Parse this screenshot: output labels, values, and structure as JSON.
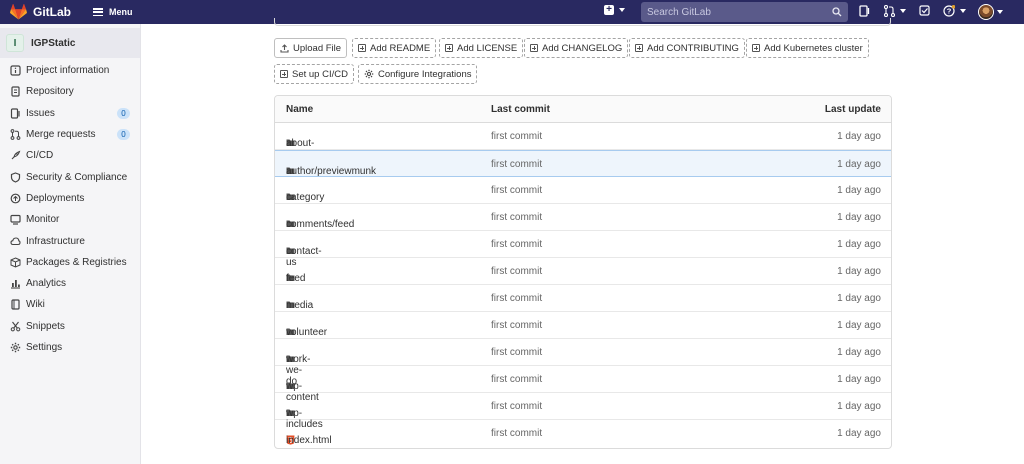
{
  "topbar": {
    "brand": "GitLab",
    "menu_label": "Menu",
    "search_placeholder": "Search GitLab"
  },
  "sidebar": {
    "project_initial": "I",
    "project_name": "IGPStatic",
    "items": [
      {
        "label": "Project information",
        "icon": "info-icon"
      },
      {
        "label": "Repository",
        "icon": "doc-icon"
      },
      {
        "label": "Issues",
        "icon": "issues-icon",
        "badge": "0"
      },
      {
        "label": "Merge requests",
        "icon": "merge-request-icon",
        "badge": "0"
      },
      {
        "label": "CI/CD",
        "icon": "rocket-icon"
      },
      {
        "label": "Security & Compliance",
        "icon": "shield-icon"
      },
      {
        "label": "Deployments",
        "icon": "deployments-icon"
      },
      {
        "label": "Monitor",
        "icon": "monitor-icon"
      },
      {
        "label": "Infrastructure",
        "icon": "cloud-icon"
      },
      {
        "label": "Packages & Registries",
        "icon": "package-icon"
      },
      {
        "label": "Analytics",
        "icon": "chart-icon"
      },
      {
        "label": "Wiki",
        "icon": "book-icon"
      },
      {
        "label": "Snippets",
        "icon": "scissors-icon"
      },
      {
        "label": "Settings",
        "icon": "gear-icon"
      }
    ]
  },
  "actions": {
    "upload": "Upload File",
    "readme": "Add README",
    "license": "Add LICENSE",
    "changelog": "Add CHANGELOG",
    "contributing": "Add CONTRIBUTING",
    "kubernetes": "Add Kubernetes cluster",
    "cicd": "Set up CI/CD",
    "integrations": "Configure Integrations"
  },
  "tree": {
    "headers": {
      "name": "Name",
      "commit": "Last commit",
      "updated": "Last update"
    },
    "rows": [
      {
        "name": "about-us",
        "type": "folder",
        "commit": "first commit",
        "updated": "1 day ago"
      },
      {
        "name": "author/previewmunk",
        "type": "folder",
        "commit": "first commit",
        "updated": "1 day ago"
      },
      {
        "name": "category",
        "type": "folder",
        "commit": "first commit",
        "updated": "1 day ago"
      },
      {
        "name": "comments/feed",
        "type": "folder",
        "commit": "first commit",
        "updated": "1 day ago"
      },
      {
        "name": "contact-us",
        "type": "folder",
        "commit": "first commit",
        "updated": "1 day ago"
      },
      {
        "name": "feed",
        "type": "folder",
        "commit": "first commit",
        "updated": "1 day ago"
      },
      {
        "name": "media",
        "type": "folder",
        "commit": "first commit",
        "updated": "1 day ago"
      },
      {
        "name": "volunteer",
        "type": "folder",
        "commit": "first commit",
        "updated": "1 day ago"
      },
      {
        "name": "work-we-do",
        "type": "folder",
        "commit": "first commit",
        "updated": "1 day ago"
      },
      {
        "name": "wp-content",
        "type": "folder",
        "commit": "first commit",
        "updated": "1 day ago"
      },
      {
        "name": "wp-includes",
        "type": "folder",
        "commit": "first commit",
        "updated": "1 day ago"
      },
      {
        "name": "index.html",
        "type": "html-file",
        "commit": "first commit",
        "updated": "1 day ago"
      }
    ]
  },
  "colors": {
    "navbar": "#292961",
    "brand_orange": "#e24329",
    "sidebar_bg": "#f5f5f7",
    "badge_bg": "#cbe2f9",
    "highlight_row": "#eef5fc"
  }
}
